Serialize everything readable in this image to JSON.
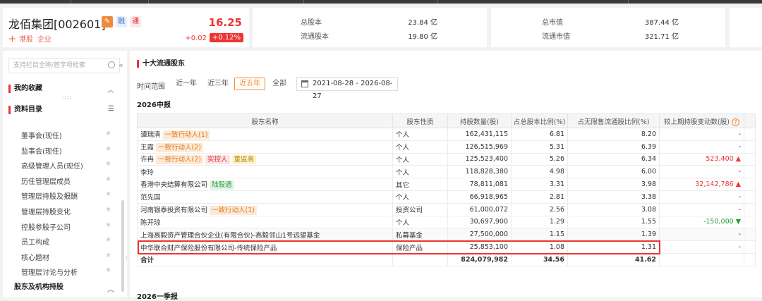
{
  "stock": {
    "name": "龙佰集团[002601]",
    "tag_rong": "融",
    "tag_tong": "通",
    "price": "16.25",
    "change": "+0.02",
    "change_pct": "+0.12%",
    "market_tag": "港股",
    "type_tag": "企业"
  },
  "metrics": {
    "total_shares_label": "总股本",
    "total_shares": "23.84 亿",
    "float_shares_label": "流通股本",
    "float_shares": "19.80 亿",
    "market_cap_label": "总市值",
    "market_cap": "387.44 亿",
    "float_cap_label": "流通市值",
    "float_cap": "321.71 亿"
  },
  "sidebar": {
    "search_placeholder": "支持栏目全称/首字母检索",
    "favorites_label": "我的收藏",
    "catalog_label": "资料目录",
    "items": [
      "董事会(现任)",
      "监事会(现任)",
      "高级管理人员(现任)",
      "历任管理层成员",
      "管理层持股及报酬",
      "管理层持股变化",
      "控股参股子公司",
      "员工构成",
      "核心题材",
      "管理层讨论与分析"
    ],
    "holders_section": "股东及机构持股"
  },
  "main": {
    "title": "十大流通股东",
    "range_label": "时间范围",
    "range_options": [
      "近一年",
      "近三年",
      "近五年",
      "全部"
    ],
    "date_range": "2021-08-28  -  2026-08-27",
    "period": "2026中报",
    "next_period": "2026一季报"
  },
  "table": {
    "headers": [
      "股东名称",
      "股东性质",
      "持股数量(股)",
      "占总股本比例(%)",
      "占无限售流通股比例(%)",
      "较上期持股变动数(股)"
    ],
    "rows": [
      {
        "name": "谭瑞清",
        "tags": [
          "一致行动人(1)"
        ],
        "nature": "个人",
        "shares": "162,431,115",
        "pct_total": "6.81",
        "pct_float": "8.20",
        "change": "-",
        "dir": ""
      },
      {
        "name": "王霞",
        "tags": [
          "一致行动人(2)"
        ],
        "nature": "个人",
        "shares": "126,515,969",
        "pct_total": "5.31",
        "pct_float": "6.39",
        "change": "-",
        "dir": ""
      },
      {
        "name": "许冉",
        "tags": [
          "一致行动人(2)",
          "实控人",
          "董监高"
        ],
        "nature": "个人",
        "shares": "125,523,400",
        "pct_total": "5.26",
        "pct_float": "6.34",
        "change": "523,400",
        "dir": "up"
      },
      {
        "name": "李玲",
        "tags": [],
        "nature": "个人",
        "shares": "118,828,380",
        "pct_total": "4.98",
        "pct_float": "6.00",
        "change": "-",
        "dir": ""
      },
      {
        "name": "香港中央结算有限公司",
        "tags": [
          "陆股通"
        ],
        "nature": "其它",
        "shares": "78,811,081",
        "pct_total": "3.31",
        "pct_float": "3.98",
        "change": "32,142,786",
        "dir": "up"
      },
      {
        "name": "范先国",
        "tags": [],
        "nature": "个人",
        "shares": "66,918,965",
        "pct_total": "2.81",
        "pct_float": "3.38",
        "change": "-",
        "dir": ""
      },
      {
        "name": "河南银泰投资有限公司",
        "tags": [
          "一致行动人(1)"
        ],
        "nature": "投资公司",
        "shares": "61,000,072",
        "pct_total": "2.56",
        "pct_float": "3.08",
        "change": "-",
        "dir": ""
      },
      {
        "name": "陈开琼",
        "tags": [],
        "nature": "个人",
        "shares": "30,697,900",
        "pct_total": "1.29",
        "pct_float": "1.55",
        "change": "-150,000",
        "dir": "down"
      },
      {
        "name": "上海高毅资产管理合伙企业(有限合伙)-高毅邻山1号远望基金",
        "tags": [],
        "nature": "私募基金",
        "shares": "27,500,000",
        "pct_total": "1.15",
        "pct_float": "1.39",
        "change": "-",
        "dir": ""
      },
      {
        "name": "中华联合财产保险股份有限公司-传统保险产品",
        "tags": [],
        "nature": "保险产品",
        "shares": "25,853,100",
        "pct_total": "1.08",
        "pct_float": "1.31",
        "change": "-",
        "dir": ""
      }
    ],
    "total": {
      "name": "合计",
      "shares": "824,079,982",
      "pct_total": "34.56",
      "pct_float": "41.62"
    }
  }
}
